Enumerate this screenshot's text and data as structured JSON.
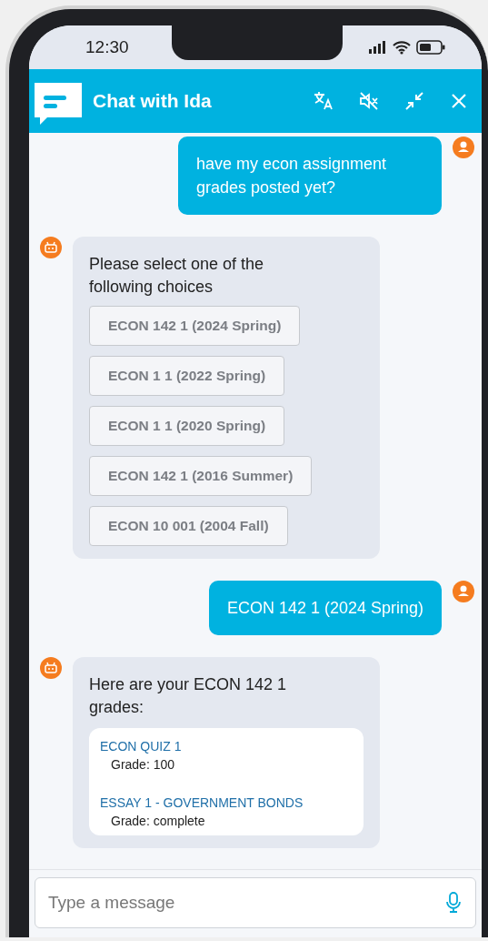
{
  "status_bar": {
    "time": "12:30"
  },
  "header": {
    "title": "Chat with Ida"
  },
  "messages": [
    {
      "kind": "user",
      "text": "have my econ assignment grades posted yet?"
    },
    {
      "kind": "choices",
      "text": "Please select one of the following choices",
      "choices": [
        "ECON 142 1 (2024 Spring)",
        "ECON 1 1 (2022 Spring)",
        "ECON 1 1 (2020 Spring)",
        "ECON 142 1 (2016 Summer)",
        "ECON 10 001 (2004 Fall)"
      ]
    },
    {
      "kind": "user",
      "text": "ECON 142 1 (2024 Spring)"
    },
    {
      "kind": "grades",
      "text": "Here are your ECON 142 1 grades:",
      "grades": [
        {
          "title": "ECON QUIZ 1",
          "grade": "Grade: 100"
        },
        {
          "title": "ESSAY 1 - GOVERNMENT BONDS",
          "grade": "Grade: complete"
        }
      ]
    }
  ],
  "composer": {
    "placeholder": "Type a message"
  }
}
